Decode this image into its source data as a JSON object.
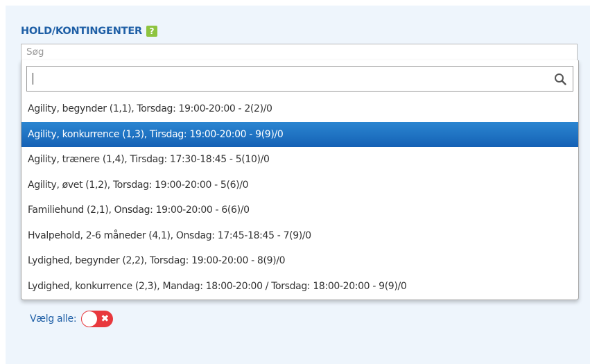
{
  "field": {
    "heading": "HOLD/KONTINGENTER",
    "help_glyph": "?",
    "placeholder": "Søg"
  },
  "dropdown": {
    "search_value": "",
    "options": [
      {
        "label": "Agility, begynder (1,1), Torsdag: 19:00-20:00 - 2(2)/0",
        "highlighted": false
      },
      {
        "label": "Agility, konkurrence (1,3), Tirsdag: 19:00-20:00 - 9(9)/0",
        "highlighted": true
      },
      {
        "label": "Agility, trænere (1,4), Tirsdag: 17:30-18:45 - 5(10)/0",
        "highlighted": false
      },
      {
        "label": "Agility, øvet (1,2), Torsdag: 19:00-20:00 - 5(6)/0",
        "highlighted": false
      },
      {
        "label": "Familiehund (2,1), Onsdag: 19:00-20:00 - 6(6)/0",
        "highlighted": false
      },
      {
        "label": "Hvalpehold, 2-6 måneder (4,1), Onsdag: 17:45-18:45 - 7(9)/0",
        "highlighted": false
      },
      {
        "label": "Lydighed, begynder (2,2), Torsdag: 19:00-20:00 - 8(9)/0",
        "highlighted": false
      },
      {
        "label": "Lydighed, konkurrence (2,3), Mandag: 18:00-20:00 / Torsdag: 18:00-20:00 - 9(9)/0",
        "highlighted": false
      }
    ]
  },
  "select_all": {
    "label": "Vælg alle:",
    "toggle_glyph": "✖",
    "state": "off"
  },
  "colors": {
    "accent": "#1f5fa6",
    "highlight": "#1d6fc1",
    "help": "#8ec43f",
    "toggle_off": "#e8383d",
    "panel_bg": "#eef5fc"
  }
}
